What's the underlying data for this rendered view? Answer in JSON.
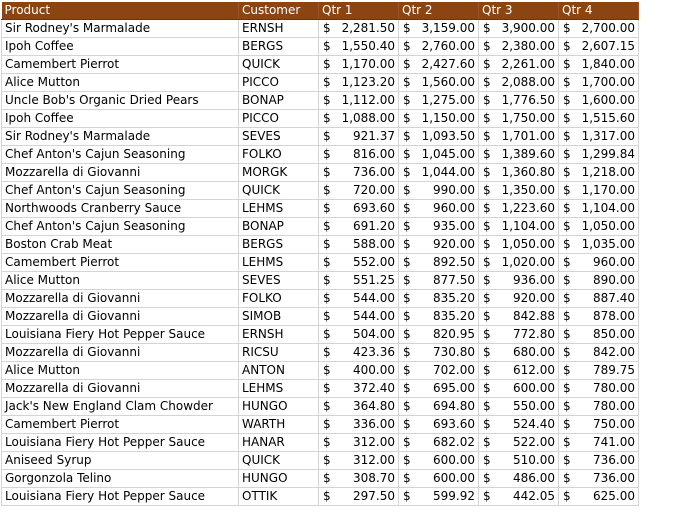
{
  "colors": {
    "header_bg": "#8b4513",
    "header_text": "#ffffff",
    "grid": "#d4d4d4"
  },
  "headers": [
    "Product",
    "Customer",
    "Qtr 1",
    "Qtr 2",
    "Qtr 3",
    "Qtr 4"
  ],
  "currency_symbol": "$",
  "rows": [
    [
      "Sir Rodney's Marmalade",
      "ERNSH",
      "2,281.50",
      "3,159.00",
      "3,900.00",
      "2,700.00"
    ],
    [
      "Ipoh Coffee",
      "BERGS",
      "1,550.40",
      "2,760.00",
      "2,380.00",
      "2,607.15"
    ],
    [
      "Camembert Pierrot",
      "QUICK",
      "1,170.00",
      "2,427.60",
      "2,261.00",
      "1,840.00"
    ],
    [
      "Alice Mutton",
      "PICCO",
      "1,123.20",
      "1,560.00",
      "2,088.00",
      "1,700.00"
    ],
    [
      "Uncle Bob's Organic Dried Pears",
      "BONAP",
      "1,112.00",
      "1,275.00",
      "1,776.50",
      "1,600.00"
    ],
    [
      "Ipoh Coffee",
      "PICCO",
      "1,088.00",
      "1,150.00",
      "1,750.00",
      "1,515.60"
    ],
    [
      "Sir Rodney's Marmalade",
      "SEVES",
      "921.37",
      "1,093.50",
      "1,701.00",
      "1,317.00"
    ],
    [
      "Chef Anton's Cajun Seasoning",
      "FOLKO",
      "816.00",
      "1,045.00",
      "1,389.60",
      "1,299.84"
    ],
    [
      "Mozzarella di Giovanni",
      "MORGK",
      "736.00",
      "1,044.00",
      "1,360.80",
      "1,218.00"
    ],
    [
      "Chef Anton's Cajun Seasoning",
      "QUICK",
      "720.00",
      "990.00",
      "1,350.00",
      "1,170.00"
    ],
    [
      "Northwoods Cranberry Sauce",
      "LEHMS",
      "693.60",
      "960.00",
      "1,223.60",
      "1,104.00"
    ],
    [
      "Chef Anton's Cajun Seasoning",
      "BONAP",
      "691.20",
      "935.00",
      "1,104.00",
      "1,050.00"
    ],
    [
      "Boston Crab Meat",
      "BERGS",
      "588.00",
      "920.00",
      "1,050.00",
      "1,035.00"
    ],
    [
      "Camembert Pierrot",
      "LEHMS",
      "552.00",
      "892.50",
      "1,020.00",
      "960.00"
    ],
    [
      "Alice Mutton",
      "SEVES",
      "551.25",
      "877.50",
      "936.00",
      "890.00"
    ],
    [
      "Mozzarella di Giovanni",
      "FOLKO",
      "544.00",
      "835.20",
      "920.00",
      "887.40"
    ],
    [
      "Mozzarella di Giovanni",
      "SIMOB",
      "544.00",
      "835.20",
      "842.88",
      "878.00"
    ],
    [
      "Louisiana Fiery Hot Pepper Sauce",
      "ERNSH",
      "504.00",
      "820.95",
      "772.80",
      "850.00"
    ],
    [
      "Mozzarella di Giovanni",
      "RICSU",
      "423.36",
      "730.80",
      "680.00",
      "842.00"
    ],
    [
      "Alice Mutton",
      "ANTON",
      "400.00",
      "702.00",
      "612.00",
      "789.75"
    ],
    [
      "Mozzarella di Giovanni",
      "LEHMS",
      "372.40",
      "695.00",
      "600.00",
      "780.00"
    ],
    [
      "Jack's New England Clam Chowder",
      "HUNGO",
      "364.80",
      "694.80",
      "550.00",
      "780.00"
    ],
    [
      "Camembert Pierrot",
      "WARTH",
      "336.00",
      "693.60",
      "524.40",
      "750.00"
    ],
    [
      "Louisiana Fiery Hot Pepper Sauce",
      "HANAR",
      "312.00",
      "682.02",
      "522.00",
      "741.00"
    ],
    [
      "Aniseed Syrup",
      "QUICK",
      "312.00",
      "600.00",
      "510.00",
      "736.00"
    ],
    [
      "Gorgonzola Telino",
      "HUNGO",
      "308.70",
      "600.00",
      "486.00",
      "736.00"
    ],
    [
      "Louisiana Fiery Hot Pepper Sauce",
      "OTTIK",
      "297.50",
      "599.92",
      "442.05",
      "625.00"
    ]
  ]
}
